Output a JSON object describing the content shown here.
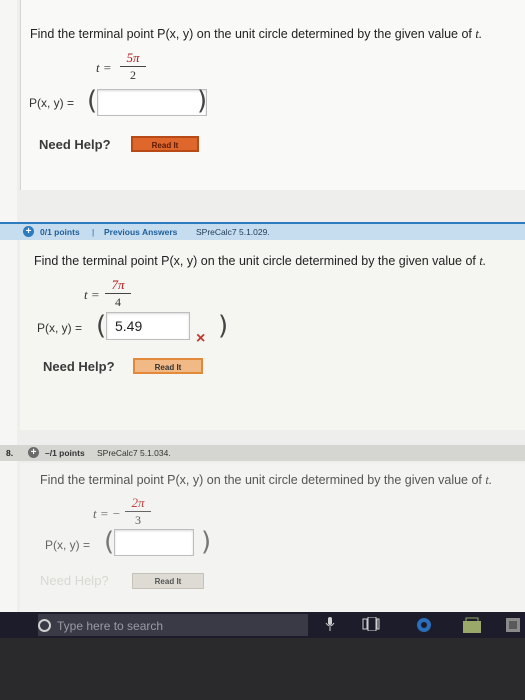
{
  "question1": {
    "prompt_prefix": "Find the terminal point ",
    "prompt_point": "P(x, y)",
    "prompt_suffix": " on the unit circle determined by the given value of ",
    "prompt_var": "t.",
    "t_label": "t =",
    "t_numerator": "5π",
    "t_denominator": "2",
    "point_label": "P(x, y) =",
    "open_paren": "(",
    "close_paren": ")",
    "answer_value": "",
    "need_help": "Need Help?",
    "read_it": "Read It"
  },
  "question2": {
    "header_score": "0/1 points",
    "header_separator": "|",
    "header_link": "Previous Answers",
    "header_source": "SPreCalc7 5.1.029.",
    "prompt_prefix": "Find the terminal point ",
    "prompt_point": "P(x, y)",
    "prompt_suffix": " on the unit circle determined by the given value of ",
    "prompt_var": "t.",
    "t_label": "t =",
    "t_numerator": "7π",
    "t_denominator": "4",
    "point_label": "P(x, y) =",
    "open_paren": "(",
    "close_paren": ")",
    "answer_value": "5.49",
    "incorrect_mark": "×",
    "need_help": "Need Help?",
    "read_it": "Read It"
  },
  "question3": {
    "number": "8.",
    "header_score": "–/1 points",
    "header_source": "SPreCalc7 5.1.034.",
    "prompt_prefix": "Find the terminal point ",
    "prompt_point": "P(x, y)",
    "prompt_suffix": " on the unit circle determined by the given value of ",
    "prompt_var": "t.",
    "t_label": "t = −",
    "t_numerator": "2π",
    "t_denominator": "3",
    "point_label": "P(x, y) =",
    "open_paren": "(",
    "close_paren": ")",
    "answer_value": "",
    "need_help": "Need Help?",
    "read_it": "Read It"
  },
  "taskbar": {
    "search_placeholder": "Type here to search"
  },
  "colors": {
    "accent_blue": "#2b7bbf",
    "header_blue": "#c6ddef",
    "incorrect_red": "#c0392b",
    "read_it_orange": "#e67e22"
  }
}
